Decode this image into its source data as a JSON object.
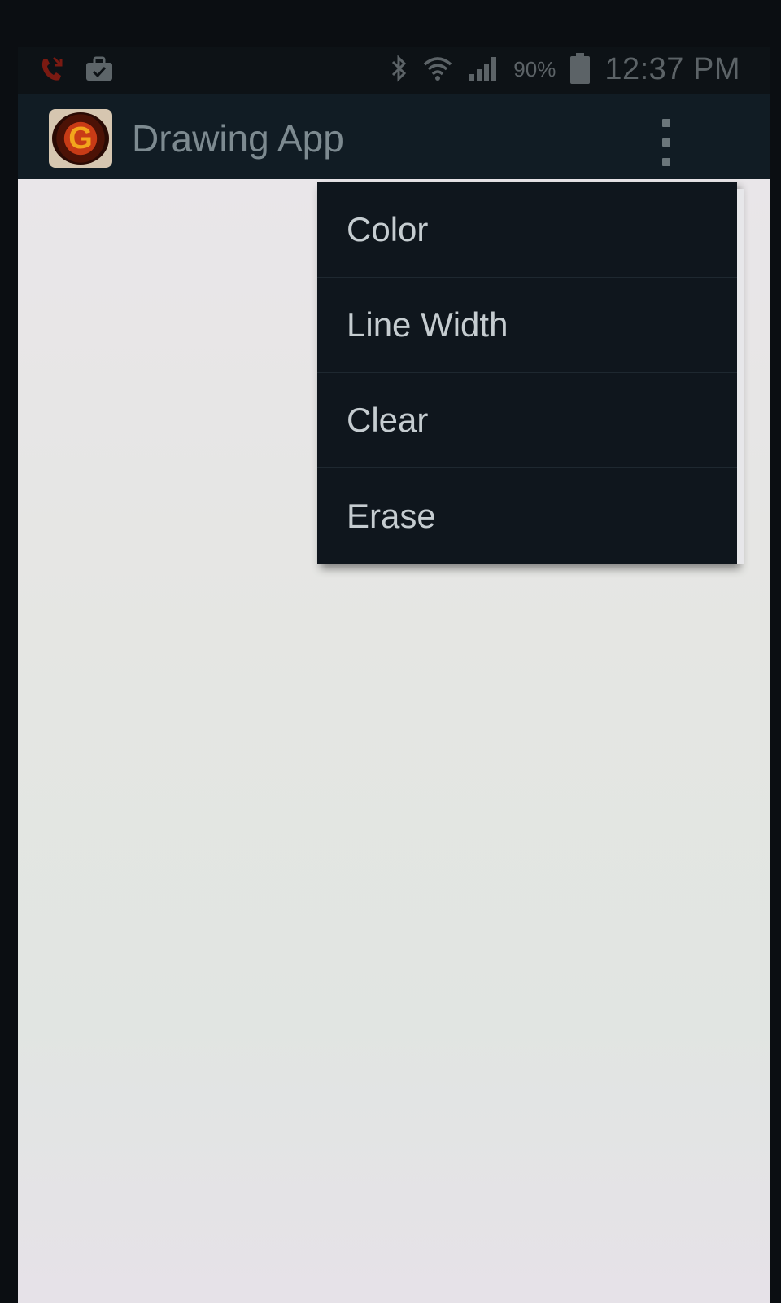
{
  "status_bar": {
    "icons": [
      "missed-call-icon",
      "briefcase-icon",
      "bluetooth-icon",
      "wifi-icon",
      "signal-icon",
      "battery-icon"
    ],
    "battery_percent": "90%",
    "time": "12:37 PM"
  },
  "action_bar": {
    "app_icon_letter": "G",
    "title": "Drawing App",
    "overflow_icon": "overflow-menu-icon"
  },
  "menu": {
    "items": [
      {
        "label": "Color"
      },
      {
        "label": "Line Width"
      },
      {
        "label": "Clear"
      },
      {
        "label": "Erase"
      }
    ]
  },
  "colors": {
    "action_bar_bg": "#111c24",
    "menu_bg": "#0f161d",
    "canvas_bg": "#ece9ea"
  }
}
